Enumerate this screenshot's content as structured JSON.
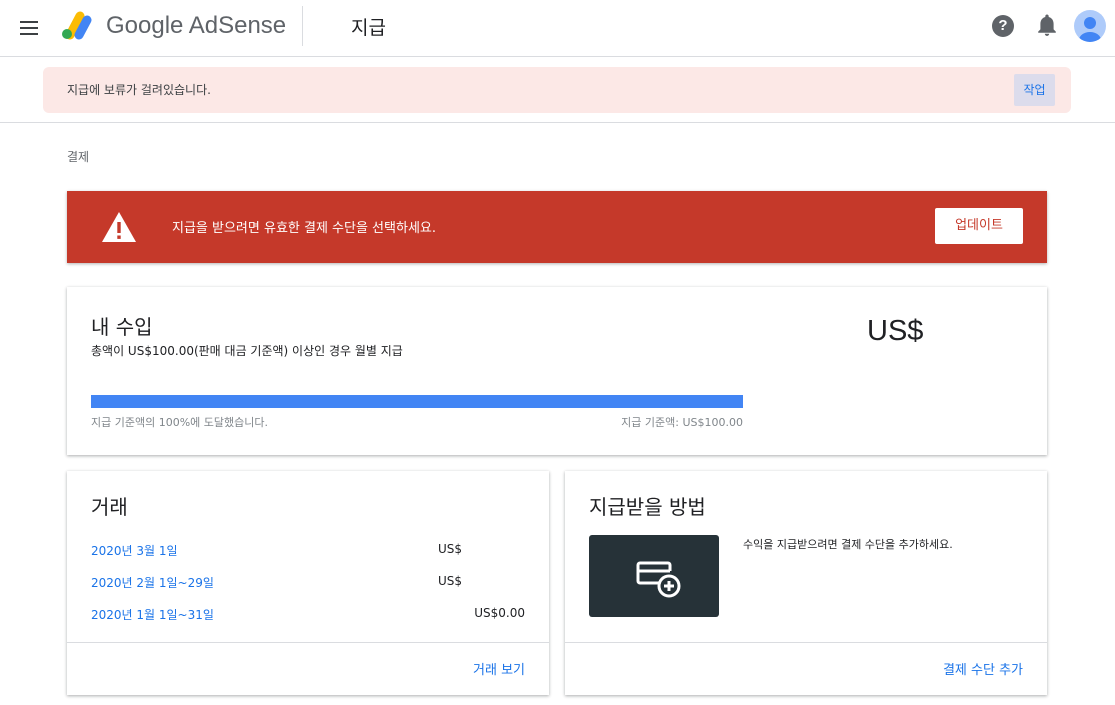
{
  "header": {
    "brand": "Google AdSense",
    "page_title": "지급",
    "help_symbol": "?",
    "icons": [
      "menu-icon",
      "adsense-logo",
      "help-icon",
      "notifications-bell-icon",
      "account-avatar"
    ]
  },
  "hold_banner": {
    "message": "지급에 보류가 걸려있습니다.",
    "action_label": "작업"
  },
  "breadcrumb": "결제",
  "alert": {
    "message": "지급을 받으려면 유효한 결제 수단을 선택하세요.",
    "button_label": "업데이트",
    "icon": "warning-icon",
    "color": "#c5392a"
  },
  "earnings": {
    "title": "내 수입",
    "subtitle": "총액이 US$100.00(판매 대금 기준액) 이상인 경우 월별 지급",
    "amount": "US$",
    "progress_percent": 100,
    "progress_label": "지급 기준액의 100%에 도달했습니다.",
    "threshold_label": "지급 기준액: US$100.00",
    "progress_color": "#4285f4"
  },
  "transactions": {
    "title": "거래",
    "rows": [
      {
        "date": "2020년 3월 1일",
        "amount": "US$"
      },
      {
        "date": "2020년 2월 1일~29일",
        "amount": "US$"
      },
      {
        "date": "2020년 1월 1일~31일",
        "amount": "US$0.00"
      }
    ],
    "link_label": "거래 보기"
  },
  "payment_method": {
    "title": "지급받을 방법",
    "description": "수익을 지급받으려면 결제 수단을 추가하세요.",
    "link_label": "결제 수단 추가",
    "icon": "add-card-icon"
  },
  "colors": {
    "link": "#1a73e8",
    "hold_banner_bg": "#fce8e6",
    "payment_tile_bg": "#263238"
  }
}
